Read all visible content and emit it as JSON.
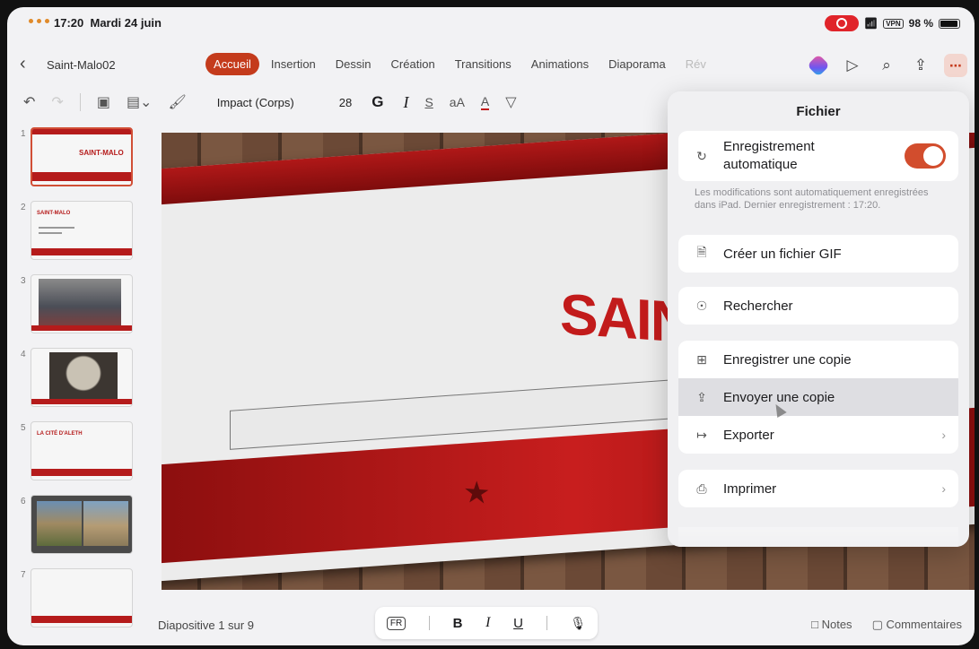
{
  "status": {
    "time": "17:20",
    "date": "Mardi 24 juin",
    "vpn": "VPN",
    "battery": "98 %"
  },
  "document": {
    "name": "Saint-Malo02",
    "back_icon": "chevron-left-icon"
  },
  "tabs": [
    {
      "label": "Accueil",
      "active": true
    },
    {
      "label": "Insertion"
    },
    {
      "label": "Dessin"
    },
    {
      "label": "Création"
    },
    {
      "label": "Transitions"
    },
    {
      "label": "Animations"
    },
    {
      "label": "Diaporama"
    },
    {
      "label": "Rév"
    }
  ],
  "ribbon": {
    "font": "Impact (Corps)",
    "size": "28",
    "bold": "G",
    "italic": "I",
    "strike": "S",
    "case": "aA"
  },
  "thumbnails": [
    {
      "number": "1",
      "title": "SAINT-MALO"
    },
    {
      "number": "2",
      "title": "SAINT-MALO"
    },
    {
      "number": "3"
    },
    {
      "number": "4"
    },
    {
      "number": "5",
      "title": "LA CITÉ D'ALETH"
    },
    {
      "number": "6"
    },
    {
      "number": "7"
    }
  ],
  "slide": {
    "title": "SAIN"
  },
  "bottom": {
    "counter": "Diapositive 1 sur 9",
    "lang": "FR",
    "bold": "B",
    "italic": "I",
    "underline": "U",
    "notes": "Notes",
    "comments": "Commentaires"
  },
  "menu": {
    "title": "Fichier",
    "autosave": {
      "label_line1": "Enregistrement",
      "label_line2": "automatique",
      "on": true
    },
    "note": "Les modifications sont automatiquement enregistrées dans iPad. Dernier enregistrement : 17:20.",
    "items": [
      {
        "label": "Créer un fichier GIF",
        "icon": "gif-file-icon"
      },
      {
        "label": "Rechercher",
        "icon": "lightbulb-icon"
      },
      {
        "label": "Enregistrer une copie",
        "icon": "save-copy-icon"
      },
      {
        "label": "Envoyer une copie",
        "icon": "share-icon"
      },
      {
        "label": "Exporter",
        "icon": "export-icon"
      },
      {
        "label": "Imprimer",
        "icon": "printer-icon"
      }
    ]
  },
  "colors": {
    "accent": "#c43b1c",
    "slide_red": "#c21b1b",
    "toggle": "#d24d2d"
  }
}
